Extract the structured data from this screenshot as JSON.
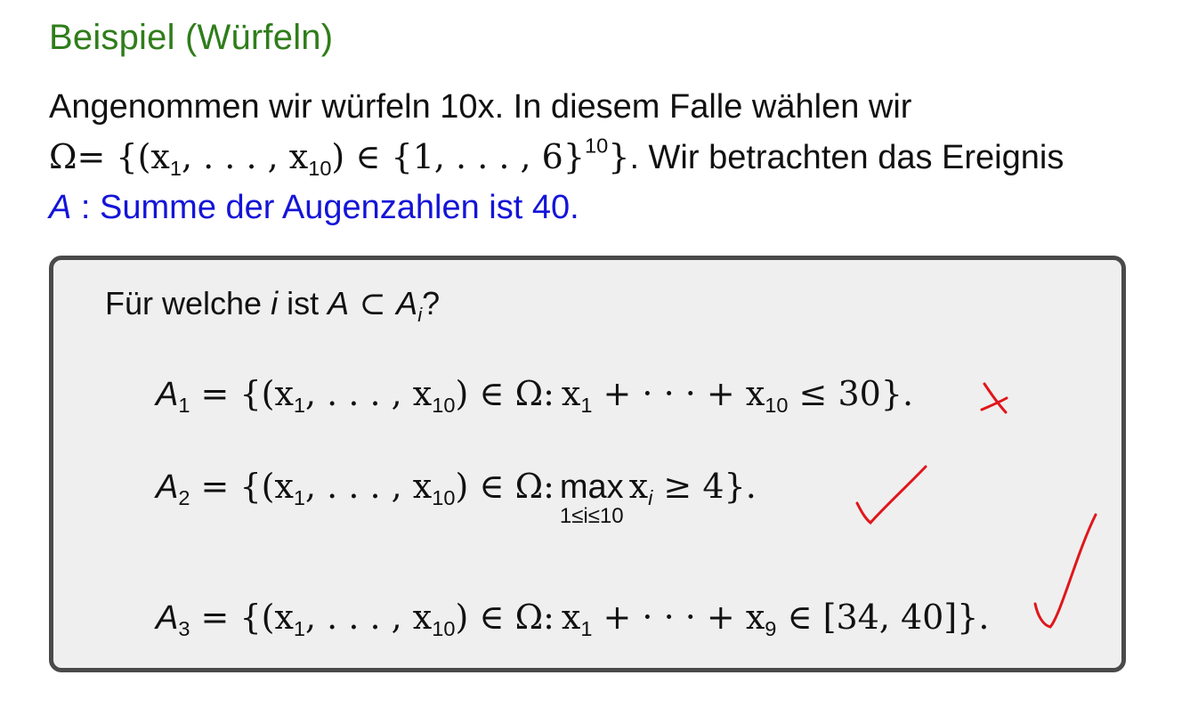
{
  "title": "Beispiel (Würfeln)",
  "intro": {
    "line1": "Angenommen wir würfeln 10x. In diesem Falle wählen wir",
    "line2_omega": "Ω",
    "line2_set": "= {(x",
    "line2_sub1": "1",
    "line2_mid": ", . . . , x",
    "line2_sub10": "10",
    "line2_after": ") ∈ {1, . . . , 6}",
    "line2_sup": "10",
    "line2_close": "}",
    "line2_text": ". Wir betrachten das Ereignis",
    "line3_var": "A",
    "line3_text": " : Summe der Augenzahlen ist 40."
  },
  "box": {
    "question_pre": "Für welche ",
    "question_i": "i",
    "question_mid": " ist ",
    "question_A": "A",
    "question_subset": " ⊂ ",
    "question_Ai": "A",
    "question_Ai_sub": "i",
    "question_end": "?",
    "eq1": {
      "lhs": "A",
      "lhs_sub": "1",
      "body_a": " = {(x",
      "s1": "1",
      "body_b": ", . . . , x",
      "s10": "10",
      "body_c": ") ∈ Ω:",
      "body_d": "x",
      "s1b": "1",
      "body_e": " + · · · + x",
      "s10b": "10",
      "body_f": " ≤ 30}."
    },
    "eq2": {
      "lhs": "A",
      "lhs_sub": "2",
      "body_a": " = {(x",
      "s1": "1",
      "body_b": ", . . . , x",
      "s10": "10",
      "body_c": ") ∈ Ω:",
      "max": "max",
      "max_under": "1≤i≤10",
      "body_d": "x",
      "si": "i",
      "body_f": " ≥ 4}."
    },
    "eq3": {
      "lhs": "A",
      "lhs_sub": "3",
      "body_a": " = {(x",
      "s1": "1",
      "body_b": ", . . . , x",
      "s10": "10",
      "body_c": ") ∈ Ω:",
      "body_d": "x",
      "s1b": "1",
      "body_e": " + · · · + x",
      "s9": "9",
      "body_f": " ∈ [34, 40]}."
    }
  },
  "annotations": {
    "eq1_mark": "cross",
    "eq2_mark": "check",
    "eq3_mark": "check",
    "ink_color": "#e0161b"
  },
  "colors": {
    "title": "#2f7d1b",
    "highlight": "#1414d8",
    "box_bg": "#efefef",
    "box_border": "#4a4a4a"
  }
}
